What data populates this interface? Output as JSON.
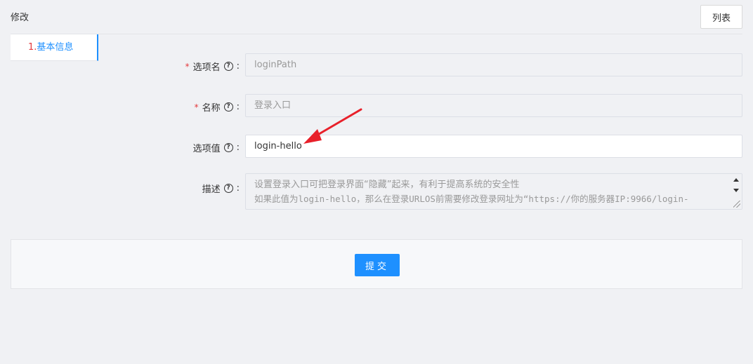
{
  "header": {
    "title": "修改",
    "list_button_label": "列表"
  },
  "steps": [
    {
      "number": "1.",
      "label": "基本信息"
    }
  ],
  "form": {
    "option_name": {
      "required": "*",
      "label": "选项名",
      "colon": ":",
      "value": "loginPath"
    },
    "display_name": {
      "required": "*",
      "label": "名称",
      "colon": ":",
      "value": "登录入口"
    },
    "option_value": {
      "label": "选项值",
      "colon": ":",
      "value": "login-hello"
    },
    "description": {
      "label": "描述",
      "colon": ":",
      "line1": "设置登录入口可把登录界面“隐藏”起来，有利于提高系统的安全性",
      "line2": "如果此值为login-hello，那么在登录URLOS前需要修改登录网址为“https://你的服务器IP:9966/login-"
    }
  },
  "help_icon_glyph": "?",
  "submit": {
    "label": "提交"
  },
  "colors": {
    "accent": "#1e90ff",
    "required": "#e4393c",
    "annotation_arrow": "#e8202a"
  }
}
